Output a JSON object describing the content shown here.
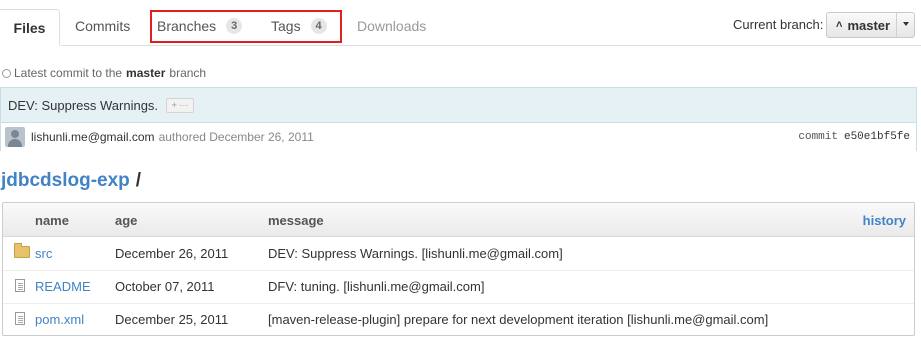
{
  "tabs": {
    "files": "Files",
    "commits": "Commits",
    "branches": "Branches",
    "branches_count": "3",
    "tags": "Tags",
    "tags_count": "4",
    "downloads": "Downloads"
  },
  "branch_selector": {
    "label": "Current branch:",
    "icon": "branch-icon",
    "value": "master"
  },
  "latest_commit": {
    "prefix": "Latest commit to the",
    "branch": "master",
    "suffix": "branch",
    "message": "DEV: Suppress Warnings.",
    "expand_label": "+ ···",
    "author": "lishunli.me@gmail.com",
    "authored": "authored December 26, 2011",
    "commit_label": "commit",
    "sha": "e50e1bf5fe"
  },
  "repo": {
    "name": "jdbcdslog-exp",
    "separator": "/"
  },
  "file_table": {
    "headers": {
      "name": "name",
      "age": "age",
      "message": "message",
      "history": "history"
    },
    "rows": [
      {
        "icon": "folder-icon",
        "name": "src",
        "age": "December 26, 2011",
        "message": "DEV: Suppress Warnings. [lishunli.me@gmail.com]"
      },
      {
        "icon": "file-icon",
        "name": "README",
        "age": "October 07, 2011",
        "message": "DFV: tuning. [lishunli.me@gmail.com]"
      },
      {
        "icon": "file-icon",
        "name": "pom.xml",
        "age": "December 25, 2011",
        "message": "[maven-release-plugin] prepare for next development iteration [lishunli.me@gmail.com]"
      }
    ]
  },
  "colors": {
    "link": "#4183c4",
    "highlight_box": "#e0201d",
    "commit_bg": "#e5f1f5"
  }
}
